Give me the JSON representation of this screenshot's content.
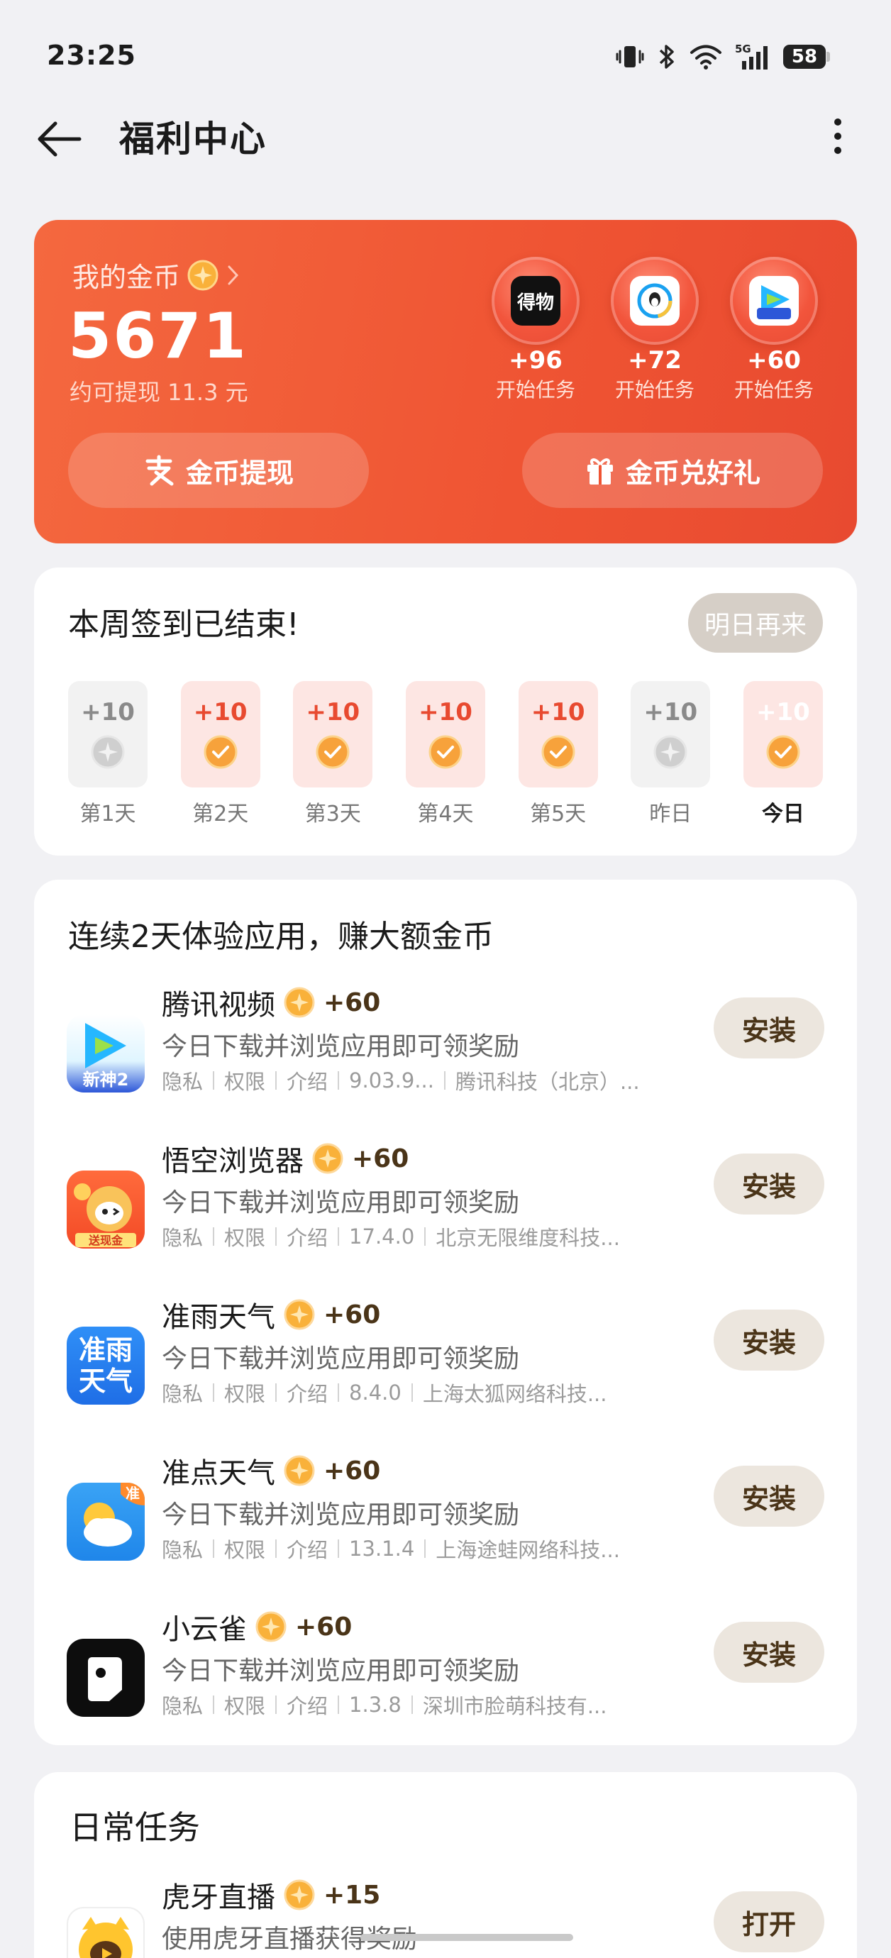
{
  "status_bar": {
    "time": "23:25",
    "battery": "58",
    "network": "5G"
  },
  "header": {
    "title": "福利中心"
  },
  "coin_card": {
    "label": "我的金币",
    "value": "5671",
    "subtext": "约可提现 11.3 元",
    "bubbles": [
      {
        "app": "得物",
        "reward": "+96",
        "caption": "开始任务",
        "icon_bg": "#111111",
        "icon_fg": "#ffffff"
      },
      {
        "app": "QQ",
        "reward": "+72",
        "caption": "开始任务",
        "icon_bg": "#ffffff",
        "icon_fg": "#1aa1f0"
      },
      {
        "app": "新神",
        "reward": "+60",
        "caption": "开始任务",
        "icon_bg": "#ffffff",
        "icon_fg": "#1aa1f0"
      }
    ],
    "withdraw_label": "金币提现",
    "exchange_label": "金币兑好礼"
  },
  "signin": {
    "title": "本周签到已结束!",
    "tomorrow_label": "明日再来",
    "days": [
      {
        "label": "第1天",
        "reward": "+10",
        "state": "missed"
      },
      {
        "label": "第2天",
        "reward": "+10",
        "state": "done"
      },
      {
        "label": "第3天",
        "reward": "+10",
        "state": "done"
      },
      {
        "label": "第4天",
        "reward": "+10",
        "state": "done"
      },
      {
        "label": "第5天",
        "reward": "+10",
        "state": "done"
      },
      {
        "label": "昨日",
        "reward": "+10",
        "state": "missed"
      },
      {
        "label": "今日",
        "reward": "+10",
        "state": "today"
      }
    ]
  },
  "app_tasks": {
    "title": "连续2天体验应用，赚大额金币",
    "privacy_label": "隐私",
    "permission_label": "权限",
    "intro_label": "介绍",
    "items": [
      {
        "name": "腾讯视频",
        "reward": "+60",
        "desc": "今日下载并浏览应用即可领奖励",
        "version": "9.03.9...",
        "developer": "腾讯科技（北京）...",
        "button": "安装",
        "icon": "tencent-video",
        "icon_text": "新神2"
      },
      {
        "name": "悟空浏览器",
        "reward": "+60",
        "desc": "今日下载并浏览应用即可领奖励",
        "version": "17.4.0",
        "developer": "北京无限维度科技...",
        "button": "安装",
        "icon": "wukong-browser",
        "icon_text": "送现金"
      },
      {
        "name": "准雨天气",
        "reward": "+60",
        "desc": "今日下载并浏览应用即可领奖励",
        "version": "8.4.0",
        "developer": "上海太狐网络科技...",
        "button": "安装",
        "icon": "zhunyu-weather",
        "icon_text": "准雨天气"
      },
      {
        "name": "准点天气",
        "reward": "+60",
        "desc": "今日下载并浏览应用即可领奖励",
        "version": "13.1.4",
        "developer": "上海途蛙网络科技...",
        "button": "安装",
        "icon": "zhundian-weather",
        "icon_text": "准"
      },
      {
        "name": "小云雀",
        "reward": "+60",
        "desc": "今日下载并浏览应用即可领奖励",
        "version": "1.3.8",
        "developer": "深圳市脸萌科技有...",
        "button": "安装",
        "icon": "xiaoyunque",
        "icon_text": ""
      }
    ]
  },
  "daily_tasks": {
    "title": "日常任务",
    "items": [
      {
        "name": "虎牙直播",
        "reward": "+15",
        "desc": "使用虎牙直播获得奖励",
        "button": "打开",
        "icon": "huya"
      }
    ]
  },
  "colors": {
    "accent": "#ef5433",
    "coin": "#f7a23b",
    "button_bg": "#ece6de",
    "button_text": "#4a3418"
  }
}
